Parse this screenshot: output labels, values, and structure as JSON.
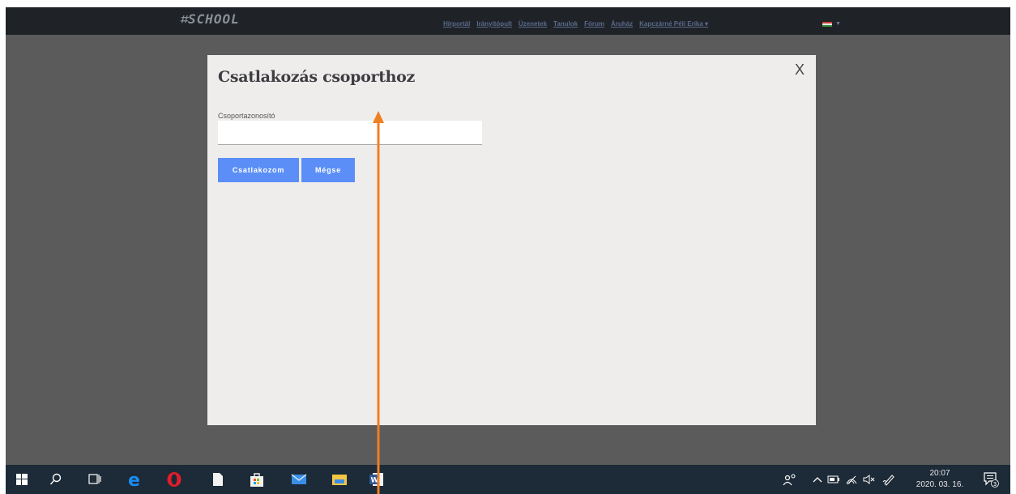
{
  "topbar": {
    "logo": "SCHOOL",
    "nav": [
      "Hírportál",
      "Irányítópult",
      "Üzenetek",
      "Tanulok",
      "Fórum",
      "Áruház",
      "Kapczárné Péli Erika ▾"
    ]
  },
  "dialog": {
    "title": "Csatlakozás csoporthoz",
    "close_label": "X",
    "field_label": "Csoportazonosító",
    "field_value": "",
    "join_label": "Csatlakozom",
    "cancel_label": "Mégse"
  },
  "taskbar": {
    "time": "20:07",
    "date": "2020. 03. 16.",
    "notification_count": "3"
  },
  "colors": {
    "accent": "#5b8ff7",
    "arrow": "#f07f23",
    "overlay": "#5b5b5b",
    "dialog_bg": "#efedec"
  },
  "icons": [
    "windows-start-icon",
    "search-icon",
    "task-view-icon",
    "edge-icon",
    "opera-icon",
    "file-icon",
    "store-icon",
    "mail-icon",
    "file-explorer-icon",
    "word-icon",
    "people-icon",
    "chevron-up-icon",
    "battery-icon",
    "wifi-icon",
    "speaker-muted-icon",
    "pen-icon",
    "notifications-icon"
  ]
}
